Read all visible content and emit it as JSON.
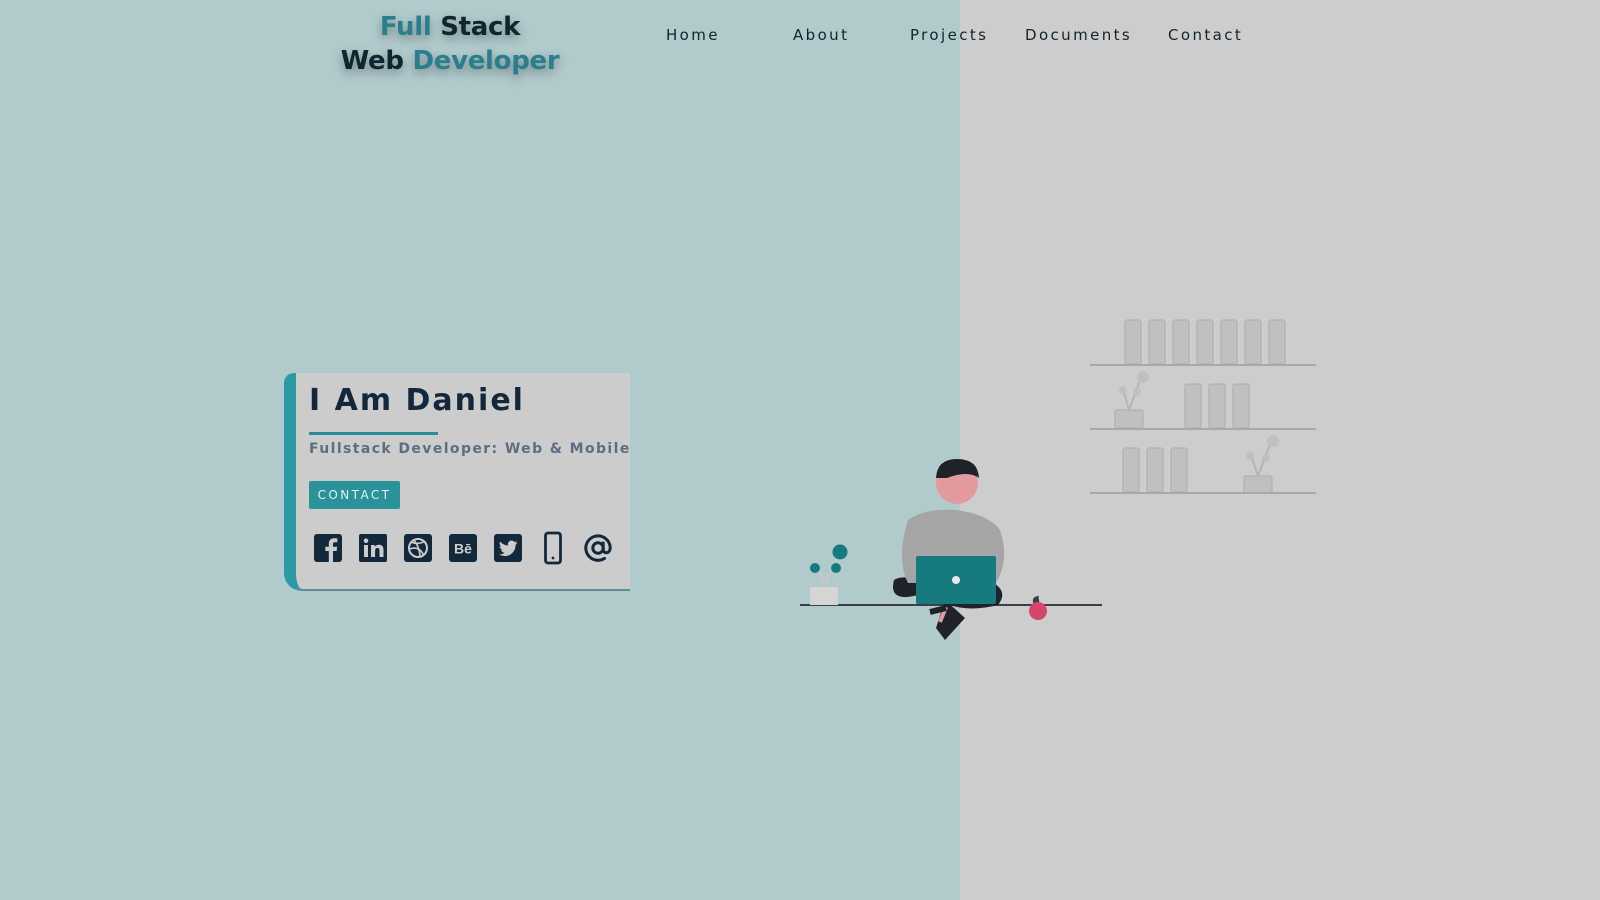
{
  "logo": {
    "line1_part1": "Full",
    "line1_part2": "Stack",
    "line2_part1": "Web",
    "line2_part2": "Developer"
  },
  "nav": {
    "items": [
      {
        "label": "Home"
      },
      {
        "label": "About"
      },
      {
        "label": "Projects"
      },
      {
        "label": "Documents"
      },
      {
        "label": "Contact"
      }
    ]
  },
  "hero": {
    "title": "I Am Daniel",
    "subtitle": "Fullstack Developer: Web & Mobile",
    "contact_button": "CONTACT",
    "social_icons": [
      "facebook-icon",
      "linkedin-icon",
      "dribbble-icon",
      "behance-icon",
      "twitter-icon",
      "phone-icon",
      "at-sign-icon"
    ],
    "behance_glyph": "Bē"
  },
  "colors": {
    "background_left": "#b1cacc",
    "background_right": "#cdcdcd",
    "accent_teal": "#2a9299",
    "dark_navy": "#13283a",
    "laptop": "#167a7e",
    "apple": "#d6456a"
  }
}
